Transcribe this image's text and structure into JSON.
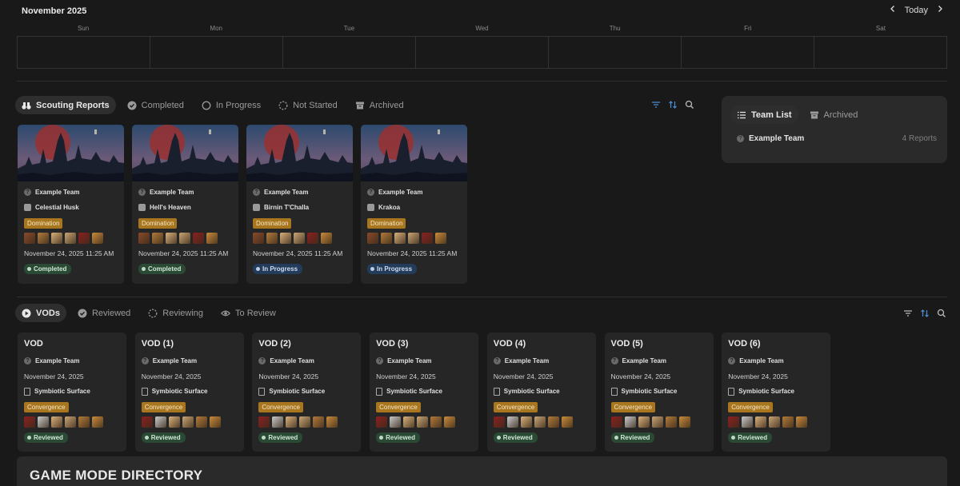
{
  "calendar": {
    "month": "November 2025",
    "today_label": "Today",
    "weekdays": [
      "Sun",
      "Mon",
      "Tue",
      "Wed",
      "Thu",
      "Fri",
      "Sat"
    ]
  },
  "scouting": {
    "tabs": [
      {
        "label": "Scouting Reports",
        "icon": "binoculars-icon",
        "active": true
      },
      {
        "label": "Completed",
        "icon": "check-circle-icon",
        "active": false
      },
      {
        "label": "In Progress",
        "icon": "circle-icon",
        "active": false
      },
      {
        "label": "Not Started",
        "icon": "dashed-circle-icon",
        "active": false
      },
      {
        "label": "Archived",
        "icon": "archive-icon",
        "active": false
      }
    ],
    "cards": [
      {
        "team": "Example Team",
        "map": "Celestial Husk",
        "map_icon": "chess-icon",
        "mode": "Domination",
        "date": "November 24, 2025 11:25 AM",
        "status": "Completed",
        "status_color": "green"
      },
      {
        "team": "Example Team",
        "map": "Hell's Heaven",
        "map_icon": "globe-icon",
        "mode": "Domination",
        "date": "November 24, 2025 11:25 AM",
        "status": "Completed",
        "status_color": "green"
      },
      {
        "team": "Example Team",
        "map": "Birnin T'Challa",
        "map_icon": "tree-icon",
        "mode": "Domination",
        "date": "November 24, 2025 11:25 AM",
        "status": "In Progress",
        "status_color": "blue"
      },
      {
        "team": "Example Team",
        "map": "Krakoa",
        "map_icon": "temple-icon",
        "mode": "Domination",
        "date": "November 24, 2025 11:25 AM",
        "status": "In Progress",
        "status_color": "blue"
      }
    ]
  },
  "team_panel": {
    "tabs": [
      {
        "label": "Team List",
        "icon": "list-icon",
        "active": true
      },
      {
        "label": "Archived",
        "icon": "archive-icon",
        "active": false
      }
    ],
    "team_name": "Example Team",
    "report_count": "4 Reports"
  },
  "vods": {
    "tabs": [
      {
        "label": "VODs",
        "icon": "play-icon",
        "active": true
      },
      {
        "label": "Reviewed",
        "icon": "check-circle-icon",
        "active": false
      },
      {
        "label": "Reviewing",
        "icon": "dashed-circle-icon",
        "active": false
      },
      {
        "label": "To Review",
        "icon": "eye-icon",
        "active": false
      }
    ],
    "cards": [
      {
        "title": "VOD",
        "team": "Example Team",
        "date": "November 24, 2025",
        "map": "Symbiotic Surface",
        "mode": "Convergence",
        "status": "Reviewed"
      },
      {
        "title": "VOD (1)",
        "team": "Example Team",
        "date": "November 24, 2025",
        "map": "Symbiotic Surface",
        "mode": "Convergence",
        "status": "Reviewed"
      },
      {
        "title": "VOD (2)",
        "team": "Example Team",
        "date": "November 24, 2025",
        "map": "Symbiotic Surface",
        "mode": "Convergence",
        "status": "Reviewed"
      },
      {
        "title": "VOD (3)",
        "team": "Example Team",
        "date": "November 24, 2025",
        "map": "Symbiotic Surface",
        "mode": "Convergence",
        "status": "Reviewed"
      },
      {
        "title": "VOD (4)",
        "team": "Example Team",
        "date": "November 24, 2025",
        "map": "Symbiotic Surface",
        "mode": "Convergence",
        "status": "Reviewed"
      },
      {
        "title": "VOD (5)",
        "team": "Example Team",
        "date": "November 24, 2025",
        "map": "Symbiotic Surface",
        "mode": "Convergence",
        "status": "Reviewed"
      },
      {
        "title": "VOD (6)",
        "team": "Example Team",
        "date": "November 24, 2025",
        "map": "Symbiotic Surface",
        "mode": "Convergence",
        "status": "Reviewed"
      }
    ]
  },
  "game_mode_directory": {
    "title": "GAME MODE DIRECTORY"
  },
  "colors": {
    "accent_blue": "#4a8fd8",
    "tag_gold": "#a8761f",
    "status_green": "#2a4a35",
    "status_blue": "#243c5c"
  }
}
